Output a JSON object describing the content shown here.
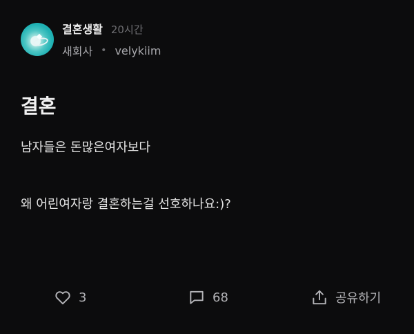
{
  "post": {
    "community": "결혼생활",
    "time_ago": "20시간",
    "affiliation": "새회사",
    "separator": "•",
    "author": "velykiim",
    "title": "결혼",
    "body_lines": [
      "남자들은 돈많은여자보다",
      "왜 어린여자랑 결혼하는걸 선호하나요:)?"
    ]
  },
  "actions": {
    "like": {
      "icon": "heart-icon",
      "count": "3"
    },
    "comment": {
      "icon": "comment-icon",
      "count": "68"
    },
    "share": {
      "icon": "share-icon",
      "label": "공유하기"
    }
  },
  "colors": {
    "background": "#0c0c0d",
    "avatar_accent": "#1fb1b3",
    "muted_text": "#6e6e72"
  }
}
